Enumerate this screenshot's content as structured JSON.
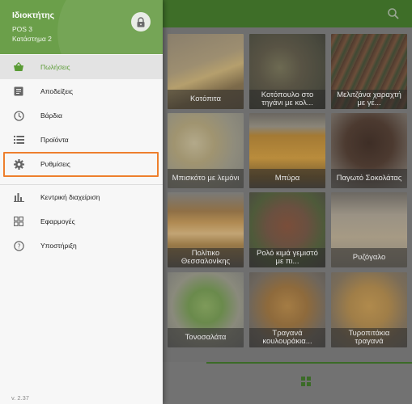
{
  "drawer": {
    "owner": "Ιδιοκτήτης",
    "pos": "POS 3",
    "store": "Κατάστημα 2",
    "lock_icon": "lock-icon",
    "items": [
      {
        "label": "Πωλήσεις",
        "icon": "basket-icon",
        "active": true
      },
      {
        "label": "Αποδείξεις",
        "icon": "receipt-icon",
        "active": false
      },
      {
        "label": "Βάρδια",
        "icon": "clock-icon",
        "active": false
      },
      {
        "label": "Προϊόντα",
        "icon": "list-icon",
        "active": false
      },
      {
        "label": "Ρυθμίσεις",
        "icon": "gear-icon",
        "active": false
      },
      {
        "label": "Κεντρική διαχείριση",
        "icon": "bar-chart-icon",
        "active": false
      },
      {
        "label": "Εφαρμογές",
        "icon": "apps-icon",
        "active": false
      },
      {
        "label": "Υποστήριξη",
        "icon": "help-icon",
        "active": false
      }
    ],
    "version": "v. 2.37"
  },
  "products": [
    {
      "name": "Κοτόπιτα"
    },
    {
      "name": "Κοτόπουλο στο τηγάνι με κολ..."
    },
    {
      "name": "Μελιτζάνα χαραχτή με γέ..."
    },
    {
      "name": "Μπισκότο με λεμόνι"
    },
    {
      "name": "Μπύρα"
    },
    {
      "name": "Παγωτό Σοκολάτας"
    },
    {
      "name": "Πολίτικο Θεσσαλονίκης"
    },
    {
      "name": "Ρολό κιμά γεμιστό με πι..."
    },
    {
      "name": "Ρυζόγαλο"
    },
    {
      "name": "Τονοσαλάτα"
    },
    {
      "name": "Τραγανά κουλουράκια..."
    },
    {
      "name": "Τυροπιτάκια τραγανά"
    }
  ],
  "colors": {
    "brand_green": "#6b9f4a",
    "active_text": "#5a9b35",
    "highlight": "#ee7f2d"
  }
}
